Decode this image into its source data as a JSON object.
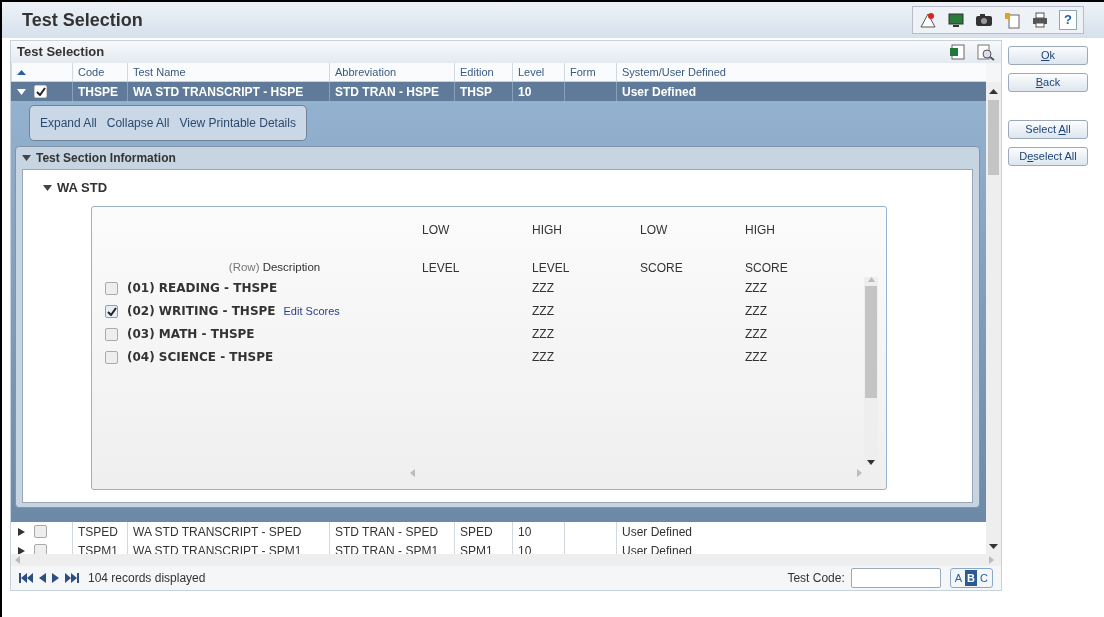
{
  "window": {
    "title": "Test Selection",
    "help_label": "?"
  },
  "panel": {
    "title": "Test Selection"
  },
  "table": {
    "columns": [
      "Code",
      "Test Name",
      "Abbreviation",
      "Edition",
      "Level",
      "Form",
      "System/User Defined"
    ],
    "rows": [
      {
        "code": "THSPE",
        "test_name": "WA STD TRANSCRIPT - HSPE",
        "abbreviation": "STD TRAN - HSPE",
        "edition": "THSP",
        "level": "10",
        "defined": "User Defined",
        "checked": true,
        "expanded": true,
        "selected": true
      },
      {
        "code": "TSPED",
        "test_name": "WA STD TRANSCRIPT - SPED",
        "abbreviation": "STD TRAN - SPED",
        "edition": "SPED",
        "level": "10",
        "defined": "User Defined",
        "checked": false,
        "expanded": false,
        "selected": false
      },
      {
        "code": "TSPM1",
        "test_name": "WA STD TRANSCRIPT - SPM1",
        "abbreviation": "STD TRAN - SPM1",
        "edition": "SPM1",
        "level": "10",
        "defined": "User Defined",
        "checked": false,
        "expanded": false,
        "selected": false
      }
    ]
  },
  "detail": {
    "actions": [
      "Expand All",
      "Collapse All",
      "View Printable Details"
    ],
    "section": {
      "title": "Test Section Information",
      "expanded": true,
      "group": {
        "title": "WA STD",
        "expanded": true,
        "row_label": "(Row)",
        "description_label": "Description",
        "columns": [
          {
            "top": "LOW",
            "bottom": "LEVEL"
          },
          {
            "top": "HIGH",
            "bottom": "LEVEL"
          },
          {
            "top": "LOW",
            "bottom": "SCORE"
          },
          {
            "top": "HIGH",
            "bottom": "SCORE"
          }
        ],
        "items": [
          {
            "label": "(01) READING - THSPE",
            "checked": false,
            "high_level": "ZZZ",
            "high_score": "ZZZ"
          },
          {
            "label": "(02) WRITING - THSPE",
            "checked": true,
            "link": "Edit Scores",
            "high_level": "ZZZ",
            "high_score": "ZZZ"
          },
          {
            "label": "(03) MATH - THSPE",
            "checked": false,
            "high_level": "ZZZ",
            "high_score": "ZZZ"
          },
          {
            "label": "(04) SCIENCE - THSPE",
            "checked": false,
            "high_level": "ZZZ",
            "high_score": "ZZZ"
          }
        ]
      }
    }
  },
  "buttons": [
    {
      "key": "O",
      "after": "k"
    },
    {
      "key": "B",
      "after": "ack"
    },
    {
      "before": "Select ",
      "key": "A",
      "after": "ll"
    },
    {
      "before": "D",
      "key": "e",
      "after": "select All"
    }
  ],
  "footer": {
    "records": "104 records displayed",
    "test_code_label": "Test Code:",
    "letters": [
      {
        "text": "A",
        "selected": false
      },
      {
        "text": "B",
        "selected": true
      },
      {
        "text": "C",
        "selected": false
      }
    ]
  }
}
